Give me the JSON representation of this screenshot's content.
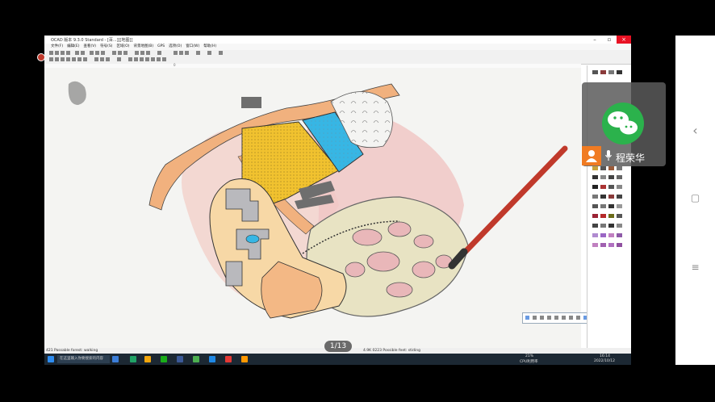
{
  "window": {
    "title": "OCAD 版本 9.3.0 Standard - [百...][[地图]]",
    "menu": [
      "文件(F)",
      "编辑(E)",
      "查看(V)",
      "符号(S)",
      "区域(O)",
      "背景地图(B)",
      "GPS",
      "选项(O)",
      "窗口(W)",
      "帮助(H)"
    ]
  },
  "canvas": {
    "ruler_mark": "0"
  },
  "statusbar": {
    "left_text": "421 Passable forest: walking",
    "right_text": "4.9K 0223 Possible feet: stiding"
  },
  "taskbar": {
    "search_placeholder": "在这里输入你要搜索的内容",
    "battery": "21%",
    "weather": "CPU利用率",
    "time": "16:14",
    "date": "2022/10/12"
  },
  "pager": {
    "text": "1/13"
  },
  "overlay": {
    "caller_name": "程荣华"
  },
  "colors": {
    "yellow_field": "#f1c22f",
    "blue_pool": "#37b6e4",
    "road": "#f1b17e",
    "pink_zone": "#f0c7c5",
    "wechat_green": "#2bb24c"
  }
}
